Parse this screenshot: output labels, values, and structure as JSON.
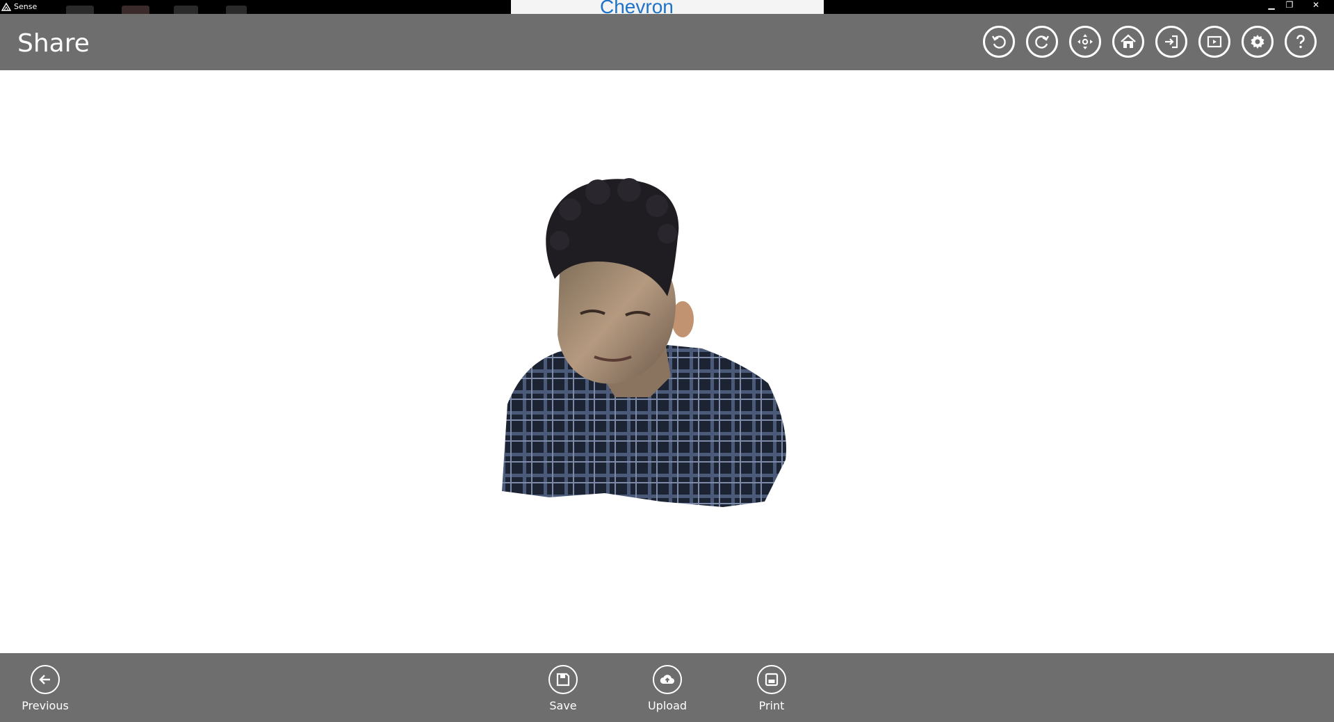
{
  "window": {
    "app_title": "Sense",
    "background_window_text": "Chevron",
    "minimize_glyph": "▁",
    "restore_glyph": "❐",
    "close_glyph": "✕"
  },
  "header": {
    "title": "Share",
    "toolbar_icons": [
      "undo-icon",
      "redo-icon",
      "move-icon",
      "home-icon",
      "import-icon",
      "slideshow-icon",
      "settings-icon",
      "help-icon"
    ]
  },
  "viewport": {
    "content": "3d-scan-model"
  },
  "appbar": {
    "previous_label": "Previous",
    "save_label": "Save",
    "upload_label": "Upload",
    "print_label": "Print"
  },
  "colors": {
    "header_bg": "#6e6e6e",
    "titlebar_bg": "#000000",
    "viewport_bg": "#ffffff",
    "foreground": "#ffffff"
  }
}
